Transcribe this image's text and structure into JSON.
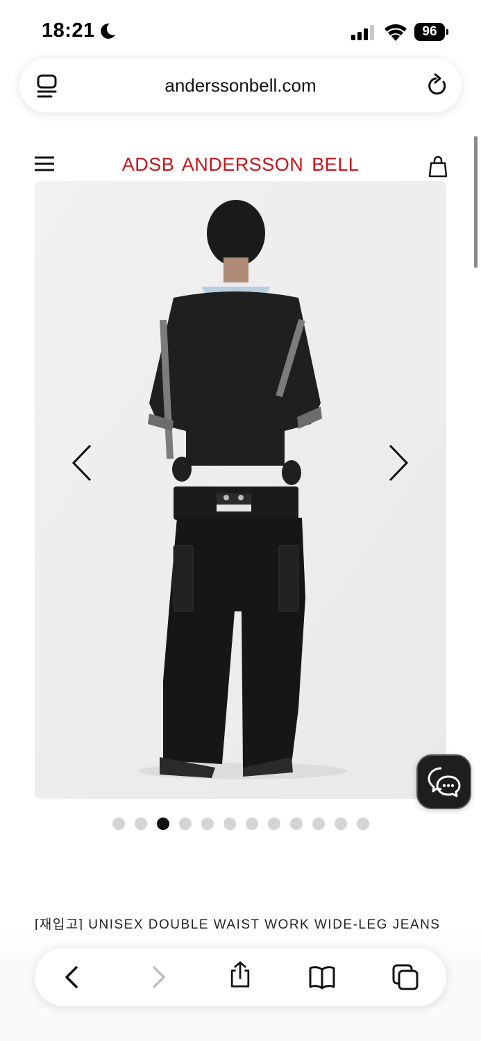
{
  "status_bar": {
    "time": "18:21",
    "battery": "96",
    "icons": [
      "moon-icon",
      "cellular-signal-icon",
      "wifi-icon",
      "battery-icon"
    ]
  },
  "browser": {
    "url": "anderssonbell.com",
    "icons": [
      "tab-overview-icon",
      "reload-icon"
    ]
  },
  "site_header": {
    "brand": "ADSB  ANDERSSON BELL",
    "brand_color": "#c4161c",
    "icons": [
      "hamburger-menu-icon",
      "shopping-bag-icon"
    ]
  },
  "gallery": {
    "total_slides": 12,
    "active_slide": 3,
    "icons": [
      "chevron-left-icon",
      "chevron-right-icon"
    ]
  },
  "chat": {
    "icon": "chat-bubbles-icon"
  },
  "product": {
    "title": "[재입고] UNISEX DOUBLE WAIST WORK WIDE-LEG JEANS"
  },
  "toolbar": {
    "icons": [
      "back-icon",
      "forward-icon",
      "share-icon",
      "bookmarks-icon",
      "tabs-icon"
    ]
  }
}
